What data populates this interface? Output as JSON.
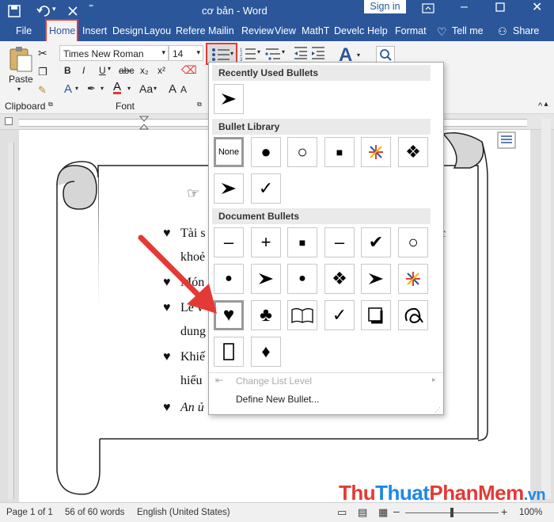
{
  "title": {
    "doc": "cơ bản",
    "sep": " - ",
    "app": "Word",
    "signin": "Sign in"
  },
  "tabs": {
    "file": "File",
    "home": "Home",
    "insert": "Insert",
    "design": "Design",
    "layout": "Layou",
    "references": "Refere",
    "mailings": "Mailin",
    "review": "Review",
    "view": "View",
    "math": "MathT",
    "developer": "Develc",
    "help": "Help",
    "format": "Format",
    "tell": "Tell me",
    "share": "Share"
  },
  "ribbon": {
    "font_name": "Times New Roman",
    "font_size": "14",
    "paste": "Paste",
    "clipboard": "Clipboard",
    "font_group": "Font",
    "bold": "B",
    "italic": "I",
    "underline": "U"
  },
  "dropdown": {
    "recent_header": "Recently Used Bullets",
    "library_header": "Bullet Library",
    "document_header": "Document Bullets",
    "none_label": "None",
    "change_level": "Change List Level",
    "define_new": "Define New Bullet..."
  },
  "document": {
    "line1": "Tài s",
    "line1_end": "c",
    "line2": "khoẻ",
    "line3": "Món",
    "line4": "Lễ v",
    "line5": "dung",
    "line6": "Khiế",
    "line7": "hiểu",
    "line8": "An ủ"
  },
  "status": {
    "page": "Page 1 of 1",
    "words": "56 of 60 words",
    "lang": "English (United States)",
    "zoom": "100%"
  },
  "watermark": {
    "part1": "Thu",
    "part2": "Thuat",
    "part3": "PhanMem",
    ".vn": ".vn"
  }
}
